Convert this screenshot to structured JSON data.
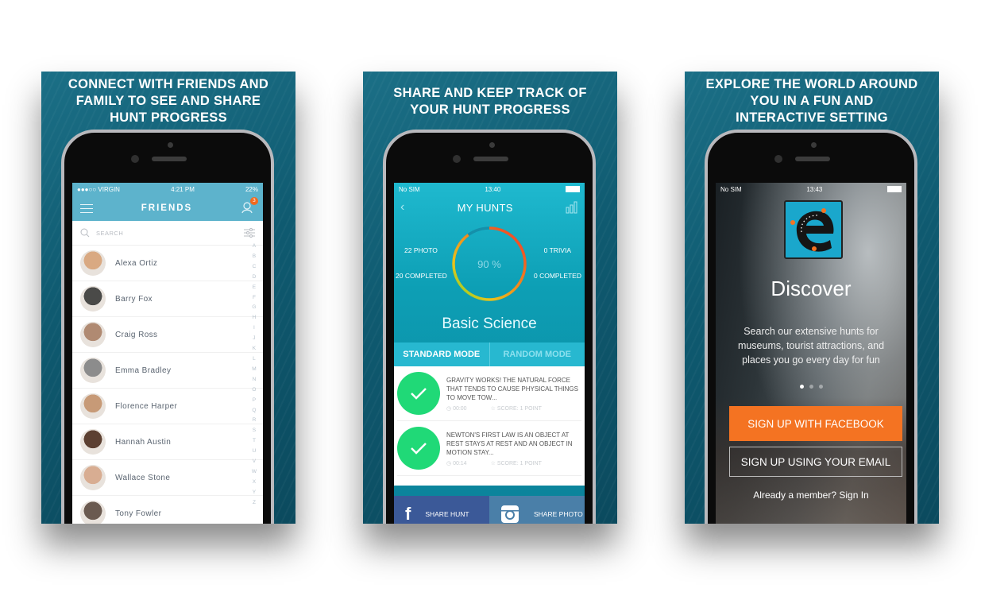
{
  "panels": [
    {
      "title": "CONNECT WITH FRIENDS AND\nFAMILY TO SEE AND SHARE\nHUNT PROGRESS",
      "status": {
        "carrier": "●●●○○ VIRGIN",
        "time": "4:21 PM",
        "battery": "22%"
      },
      "nav_title": "FRIENDS",
      "notification_count": "3",
      "search_placeholder": "SEARCH",
      "friends": [
        {
          "name": "Alexa Ortiz",
          "color": "#d9a982"
        },
        {
          "name": "Barry Fox",
          "color": "#4a4a48"
        },
        {
          "name": "Craig Ross",
          "color": "#b08a72"
        },
        {
          "name": "Emma Bradley",
          "color": "#8c8c8c"
        },
        {
          "name": "Florence Harper",
          "color": "#c79a77"
        },
        {
          "name": "Hannah Austin",
          "color": "#5c4032"
        },
        {
          "name": "Wallace Stone",
          "color": "#d8ad92"
        },
        {
          "name": "Tony Fowler",
          "color": "#6a5a50"
        }
      ],
      "alphabet": [
        "A",
        "B",
        "C",
        "D",
        "E",
        "F",
        "G",
        "H",
        "I",
        "J",
        "K",
        "L",
        "M",
        "N",
        "O",
        "P",
        "Q",
        "R",
        "S",
        "T",
        "U",
        "V",
        "W",
        "X",
        "Y",
        "Z"
      ]
    },
    {
      "title": "SHARE AND KEEP TRACK OF\nYOUR HUNT PROGRESS",
      "status": {
        "carrier": "No SIM",
        "time": "13:40"
      },
      "nav_title": "MY HUNTS",
      "photo_count": "22 PHOTO",
      "photo_completed": "20 COMPLETED",
      "trivia_count": "0 TRIVIA",
      "trivia_completed": "0 COMPLETED",
      "progress_label": "90 %",
      "progress_value": 0.9,
      "course": "Basic Science",
      "modes": [
        "STANDARD MODE",
        "RANDOM MODE"
      ],
      "questions": [
        {
          "text": "GRAVITY WORKS!  THE NATURAL FORCE THAT TENDS TO CAUSE PHYSICAL THINGS TO MOVE TOW...",
          "time": "00:00",
          "score": "SCORE: 1 POINT"
        },
        {
          "text": "NEWTON'S FIRST LAW IS AN OBJECT AT REST STAYS AT REST AND AN OBJECT IN MOTION STAY...",
          "time": "00:14",
          "score": "SCORE: 1 POINT"
        }
      ],
      "share_hunt": "SHARE HUNT",
      "share_photo": "SHARE PHOTO",
      "colors": {
        "facebook": "#3b5998",
        "instagram": "#4a7fa8",
        "check": "#20d977"
      }
    },
    {
      "title": "EXPLORE THE WORLD AROUND\nYOU IN A FUN AND\nINTERACTIVE SETTING",
      "status": {
        "carrier": "No SIM",
        "time": "13:43"
      },
      "heading": "Discover",
      "description": "Search our extensive hunts for\nmuseums, tourist attractions, and\nplaces you go every day for fun",
      "facebook_button": "SIGN UP WITH FACEBOOK",
      "email_button": "SIGN UP USING YOUR EMAIL",
      "signin_text": "Already a member? Sign In",
      "colors": {
        "facebook_button": "#f47322"
      }
    }
  ]
}
